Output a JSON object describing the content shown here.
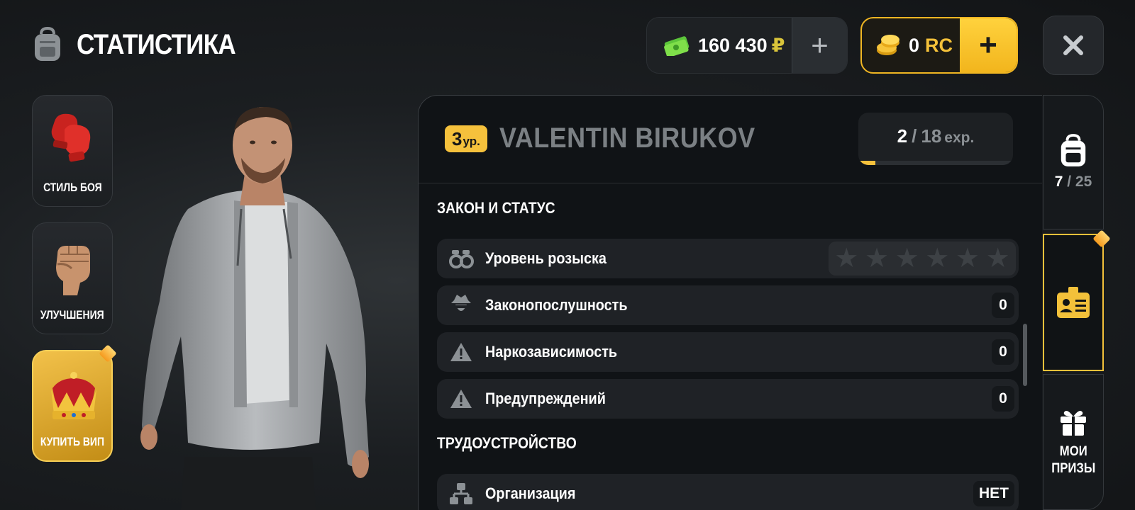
{
  "header": {
    "title": "СТАТИСТИКА",
    "money": {
      "amount": "160 430",
      "currency": "₽",
      "add_label": "+"
    },
    "rc": {
      "amount": "0",
      "currency": "RC",
      "add_label": "+"
    },
    "close_icon": "close-icon"
  },
  "left_menu": {
    "items": [
      {
        "label": "СТИЛЬ БОЯ",
        "icon": "boxing-gloves-icon"
      },
      {
        "label": "УЛУЧШЕНИЯ",
        "icon": "fist-icon"
      },
      {
        "label": "КУПИТЬ ВИП",
        "icon": "crown-icon"
      }
    ]
  },
  "player": {
    "level_number": "3",
    "level_unit": "ур.",
    "name": "VALENTIN BIRUKOV",
    "exp_current": "2",
    "exp_max": "18",
    "exp_unit": "exp.",
    "exp_progress": 0.11
  },
  "sections": {
    "law": {
      "title": "ЗАКОН И СТАТУС",
      "rows": [
        {
          "label": "Уровень розыска",
          "icon": "handcuffs-icon",
          "stars_filled": 0,
          "stars_total": 6
        },
        {
          "label": "Законопослушность",
          "icon": "detective-icon",
          "value": "0"
        },
        {
          "label": "Наркозависимость",
          "icon": "warning-icon",
          "value": "0"
        },
        {
          "label": "Предупреждений",
          "icon": "warning-icon",
          "value": "0"
        }
      ]
    },
    "employment": {
      "title": "ТРУДОУСТРОЙСТВО",
      "rows": [
        {
          "label": "Организация",
          "icon": "organization-icon",
          "value": "НЕТ"
        }
      ]
    }
  },
  "right_tabs": {
    "inventory": {
      "current": "7",
      "max": "25",
      "icon": "backpack-icon"
    },
    "stats": {
      "icon": "id-card-icon"
    },
    "prizes": {
      "label_line1": "МОИ",
      "label_line2": "ПРИЗЫ",
      "icon": "gift-icon"
    }
  },
  "colors": {
    "accent": "#f5c13c",
    "background": "#15181b",
    "money_currency": "#d9c43a"
  }
}
